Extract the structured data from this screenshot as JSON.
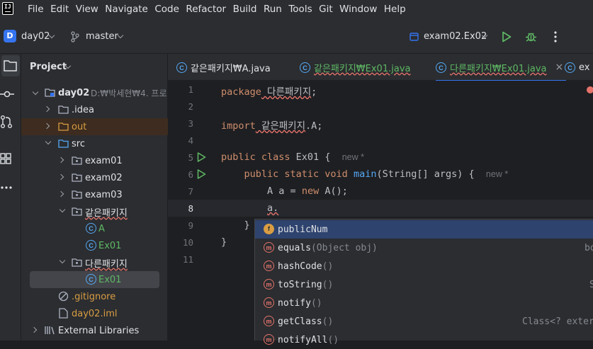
{
  "app": {
    "logo_text": "IJ"
  },
  "menu": [
    "File",
    "Edit",
    "View",
    "Navigate",
    "Code",
    "Refactor",
    "Build",
    "Run",
    "Tools",
    "Git",
    "Window",
    "Help"
  ],
  "toolbar": {
    "project_badge": "D",
    "project_name": "day02",
    "branch": "master",
    "run_config": "exam02.Ex02"
  },
  "project_panel": {
    "title": "Project",
    "root_name": "day02",
    "root_path": "D:₩박세현₩4. 프로",
    "tree": [
      ".idea",
      "out",
      "src",
      "exam01",
      "exam02",
      "exam03",
      "같은패키지",
      "A",
      "Ex01",
      "다른패키지",
      "Ex01",
      ".gitignore",
      "day02.iml",
      "External Libraries"
    ]
  },
  "tabs": [
    {
      "label": "같은패키지₩A.java"
    },
    {
      "label": "같은패키지₩Ex01.java"
    },
    {
      "label": "다른패키지₩Ex01.java"
    },
    {
      "label": "ex"
    }
  ],
  "editor": {
    "line_numbers": [
      "1",
      "2",
      "3",
      "4",
      "5",
      "6",
      "7",
      "8",
      "9",
      "10",
      "11"
    ],
    "lines": {
      "l1_kw": "package",
      "l1_rest": " 다른패키지",
      "l1_end": ";",
      "l3_kw": "import",
      "l3_rest": " 같은패키지",
      "l3_end": ".A;",
      "l5_kw": "public class",
      "l5_rest": " Ex01 {",
      "l5_hint": "new *",
      "l6_kw": "public static void",
      "l6_fn": "main",
      "l6_rest": "(String[] args) {",
      "l6_hint": "new *",
      "l7_a": "A a = ",
      "l7_kw": "new",
      "l7_b": " A();",
      "l8": "a.",
      "l9": "}",
      "l10": "}"
    }
  },
  "completion": [
    {
      "icon": "f",
      "name": "publicNum",
      "params": "",
      "right": ""
    },
    {
      "icon": "m",
      "name": "equals",
      "params": "(Object obj)",
      "right": "bo"
    },
    {
      "icon": "m",
      "name": "hashCode",
      "params": "()",
      "right": ""
    },
    {
      "icon": "m",
      "name": "toString",
      "params": "()",
      "right": "S"
    },
    {
      "icon": "m",
      "name": "notify",
      "params": "()",
      "right": ""
    },
    {
      "icon": "m",
      "name": "getClass",
      "params": "()",
      "right": "Class<? exter"
    },
    {
      "icon": "m",
      "name": "notifyAll",
      "params": "()",
      "right": ""
    }
  ],
  "colors": {
    "accent": "#3574f0",
    "keyword": "#cf8e6d",
    "method": "#56a8f5",
    "run_green": "#5fb865"
  }
}
